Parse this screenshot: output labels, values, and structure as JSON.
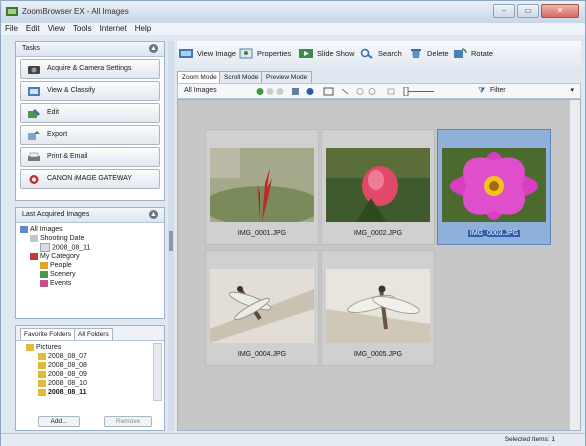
{
  "window": {
    "title": "ZoomBrowser EX - All Images",
    "buttons": {
      "minimize": "–",
      "maximize": "▭",
      "close": "✕"
    }
  },
  "menu": [
    "File",
    "Edit",
    "View",
    "Tools",
    "Internet",
    "Help"
  ],
  "tasks": {
    "title": "Tasks",
    "items": [
      {
        "label": "Acquire & Camera Settings",
        "icon": "camera-icon"
      },
      {
        "label": "View & Classify",
        "icon": "view-icon"
      },
      {
        "label": "Edit",
        "icon": "edit-icon"
      },
      {
        "label": "Export",
        "icon": "export-icon"
      },
      {
        "label": "Print & Email",
        "icon": "print-icon"
      },
      {
        "label": "CANON iMAGE GATEWAY",
        "icon": "gateway-icon"
      }
    ]
  },
  "last_acquired": {
    "title": "Last Acquired Images",
    "tree": [
      {
        "label": "All Images",
        "level": 0,
        "icon": "images-icon"
      },
      {
        "label": "Shooting Date",
        "level": 1,
        "icon": "calendar-icon"
      },
      {
        "label": "2008_08_11",
        "level": 2,
        "icon": "calendar-day-icon"
      },
      {
        "label": "My Category",
        "level": 1,
        "icon": "category-icon"
      },
      {
        "label": "People",
        "level": 2,
        "icon": "people-icon"
      },
      {
        "label": "Scenery",
        "level": 2,
        "icon": "scenery-icon"
      },
      {
        "label": "Events",
        "level": 2,
        "icon": "events-icon"
      }
    ]
  },
  "folders": {
    "tabs": [
      "Favorite Folders",
      "All Folders"
    ],
    "tree": [
      {
        "label": "Pictures",
        "level": 0
      },
      {
        "label": "2008_08_07",
        "level": 1
      },
      {
        "label": "2008_08_08",
        "level": 1
      },
      {
        "label": "2008_08_09",
        "level": 1
      },
      {
        "label": "2008_08_10",
        "level": 1
      },
      {
        "label": "2008_08_11",
        "level": 1
      }
    ],
    "add_label": "Add...",
    "remove_label": "Remove"
  },
  "toolbar": {
    "buttons": [
      {
        "label": "View Image",
        "icon": "view-image-icon"
      },
      {
        "label": "Properties",
        "icon": "properties-icon"
      },
      {
        "label": "Slide Show",
        "icon": "slideshow-icon"
      },
      {
        "label": "Search",
        "icon": "search-icon"
      },
      {
        "label": "Delete",
        "icon": "delete-icon"
      },
      {
        "label": "Rotate",
        "icon": "rotate-icon"
      }
    ]
  },
  "modes": {
    "tabs": [
      "Zoom Mode",
      "Scroll Mode",
      "Preview Mode"
    ],
    "active": 0
  },
  "view": {
    "label": "All Images",
    "filter_label": "Filter"
  },
  "thumbnails": [
    {
      "name": "IMG_0001.JPG",
      "selected": false,
      "scene": "red-bud"
    },
    {
      "name": "IMG_0002.JPG",
      "selected": false,
      "scene": "pink-bud"
    },
    {
      "name": "IMG_0003.JPG",
      "selected": true,
      "scene": "purple-flower"
    },
    {
      "name": "IMG_0004.JPG",
      "selected": false,
      "scene": "dragonfly-1"
    },
    {
      "name": "IMG_0005.JPG",
      "selected": false,
      "scene": "dragonfly-2"
    }
  ],
  "status": {
    "selected_text": "Selected Items: 1"
  }
}
